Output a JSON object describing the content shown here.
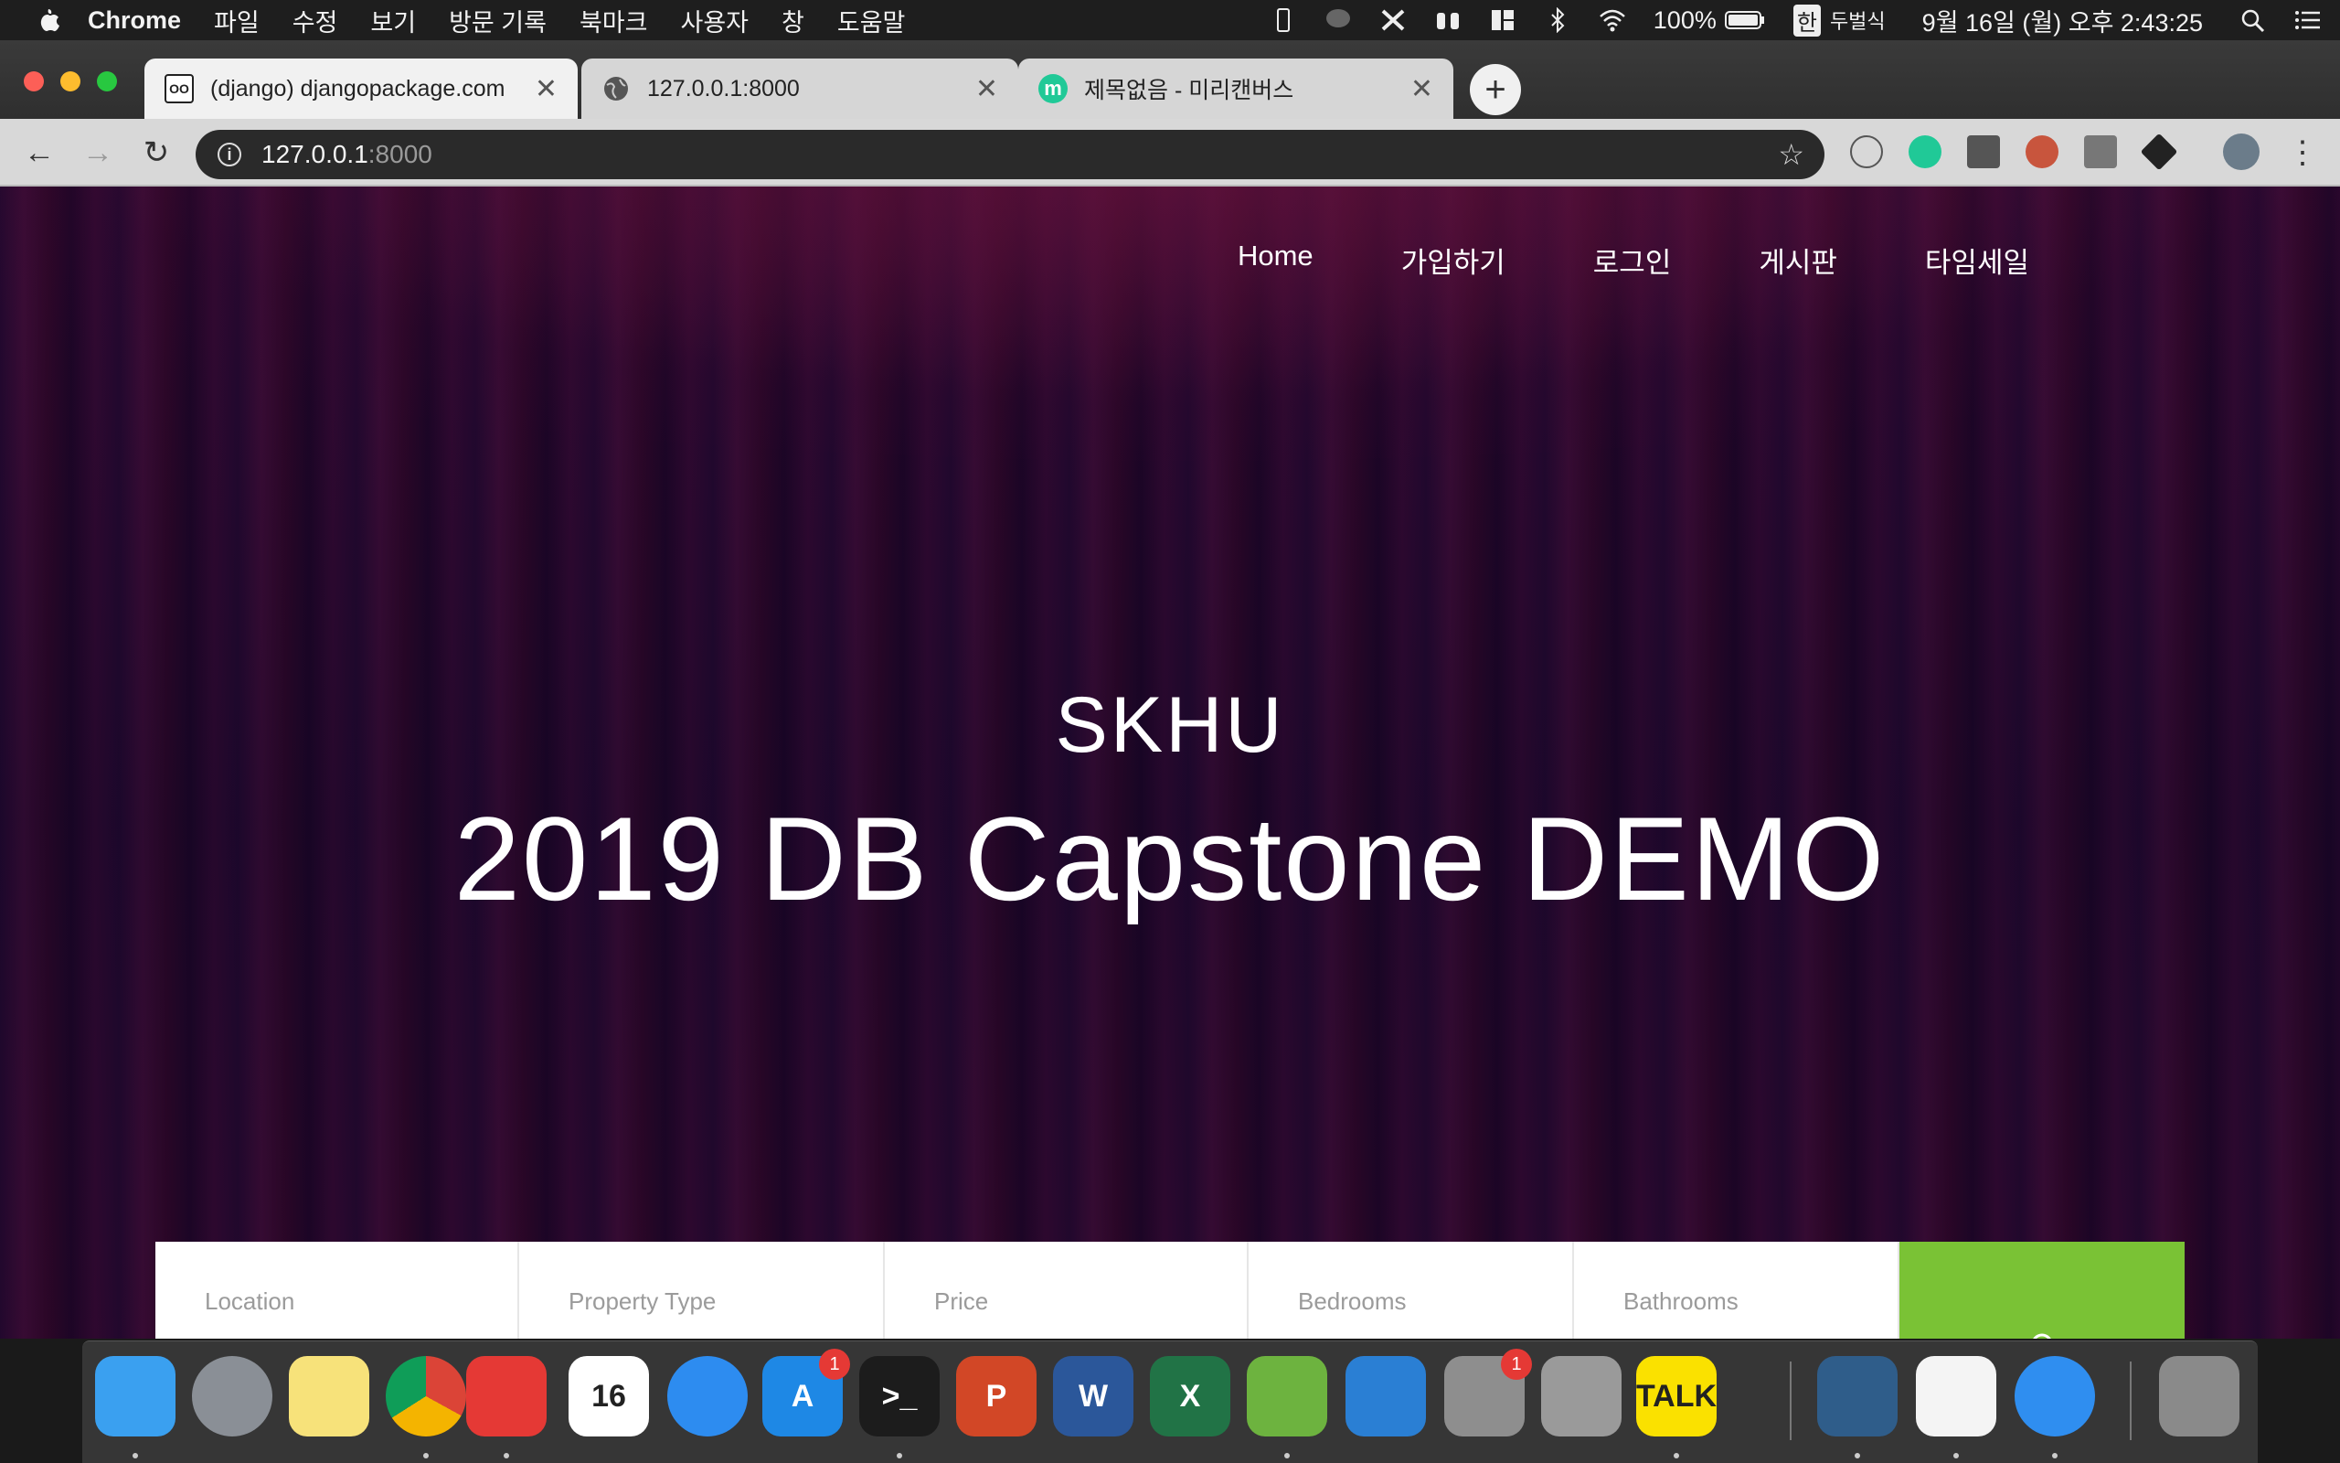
{
  "menubar": {
    "app_name": "Chrome",
    "menus": [
      "파일",
      "수정",
      "보기",
      "방문 기록",
      "북마크",
      "사용자",
      "창",
      "도움말"
    ],
    "battery": "100%",
    "input_source": "한",
    "input_method": "두벌식",
    "datetime": "9월 16일 (월) 오후 2:43:25"
  },
  "tabs": [
    {
      "label": "(django) djangopackage.com",
      "active": true,
      "favicon": "oo-favicon"
    },
    {
      "label": "127.0.0.1:8000",
      "active": false,
      "favicon": "globe-favicon"
    },
    {
      "label": "제목없음 - 미리캔버스",
      "active": false,
      "favicon": "miricanvas-favicon"
    }
  ],
  "newtab_label": "+",
  "omnibox": {
    "host": "127.0.0.1",
    "port": ":8000"
  },
  "site": {
    "nav": [
      "Home",
      "가입하기",
      "로그인",
      "게시판",
      "타임세일"
    ],
    "hero_subtitle": "SKHU",
    "hero_title": "2019 DB Capstone DEMO",
    "search_fields": [
      "Location",
      "Property Type",
      "Price",
      "Bedrooms",
      "Bathrooms"
    ]
  },
  "dock": {
    "apps": [
      {
        "name": "finder",
        "color": "#3aa0f0",
        "glyph": ""
      },
      {
        "name": "launchpad",
        "color": "#8a8f96",
        "glyph": ""
      },
      {
        "name": "notes",
        "color": "#f7e27a",
        "glyph": ""
      },
      {
        "name": "chrome",
        "color": "#ffffff",
        "glyph": ""
      },
      {
        "name": "mail",
        "color": "#e53935",
        "glyph": ""
      },
      {
        "name": "calendar",
        "color": "#ffffff",
        "glyph": "16"
      },
      {
        "name": "messages",
        "color": "#2d8cf0",
        "glyph": ""
      },
      {
        "name": "app-store",
        "color": "#1e88e5",
        "glyph": "A",
        "badge": "1"
      },
      {
        "name": "terminal",
        "color": "#1c1c1c",
        "glyph": ">_"
      },
      {
        "name": "powerpoint",
        "color": "#d24726",
        "glyph": "P"
      },
      {
        "name": "word",
        "color": "#2b579a",
        "glyph": "W"
      },
      {
        "name": "excel",
        "color": "#217346",
        "glyph": "X"
      },
      {
        "name": "spring",
        "color": "#6db33f",
        "glyph": ""
      },
      {
        "name": "vscode",
        "color": "#2a7fd4",
        "glyph": ""
      },
      {
        "name": "system-preferences",
        "color": "#8e8e8e",
        "glyph": "",
        "badge": "1"
      },
      {
        "name": "calculator",
        "color": "#9a9a9a",
        "glyph": ""
      },
      {
        "name": "kakaotalk",
        "color": "#fae100",
        "glyph": "TALK"
      },
      {
        "name": "mysql-workbench",
        "color": "#2f5d8a",
        "glyph": ""
      },
      {
        "name": "textedit",
        "color": "#f4f4f4",
        "glyph": ""
      },
      {
        "name": "safari",
        "color": "#2f8ef0",
        "glyph": ""
      },
      {
        "name": "trash",
        "color": "#8a8a8a",
        "glyph": ""
      }
    ]
  }
}
